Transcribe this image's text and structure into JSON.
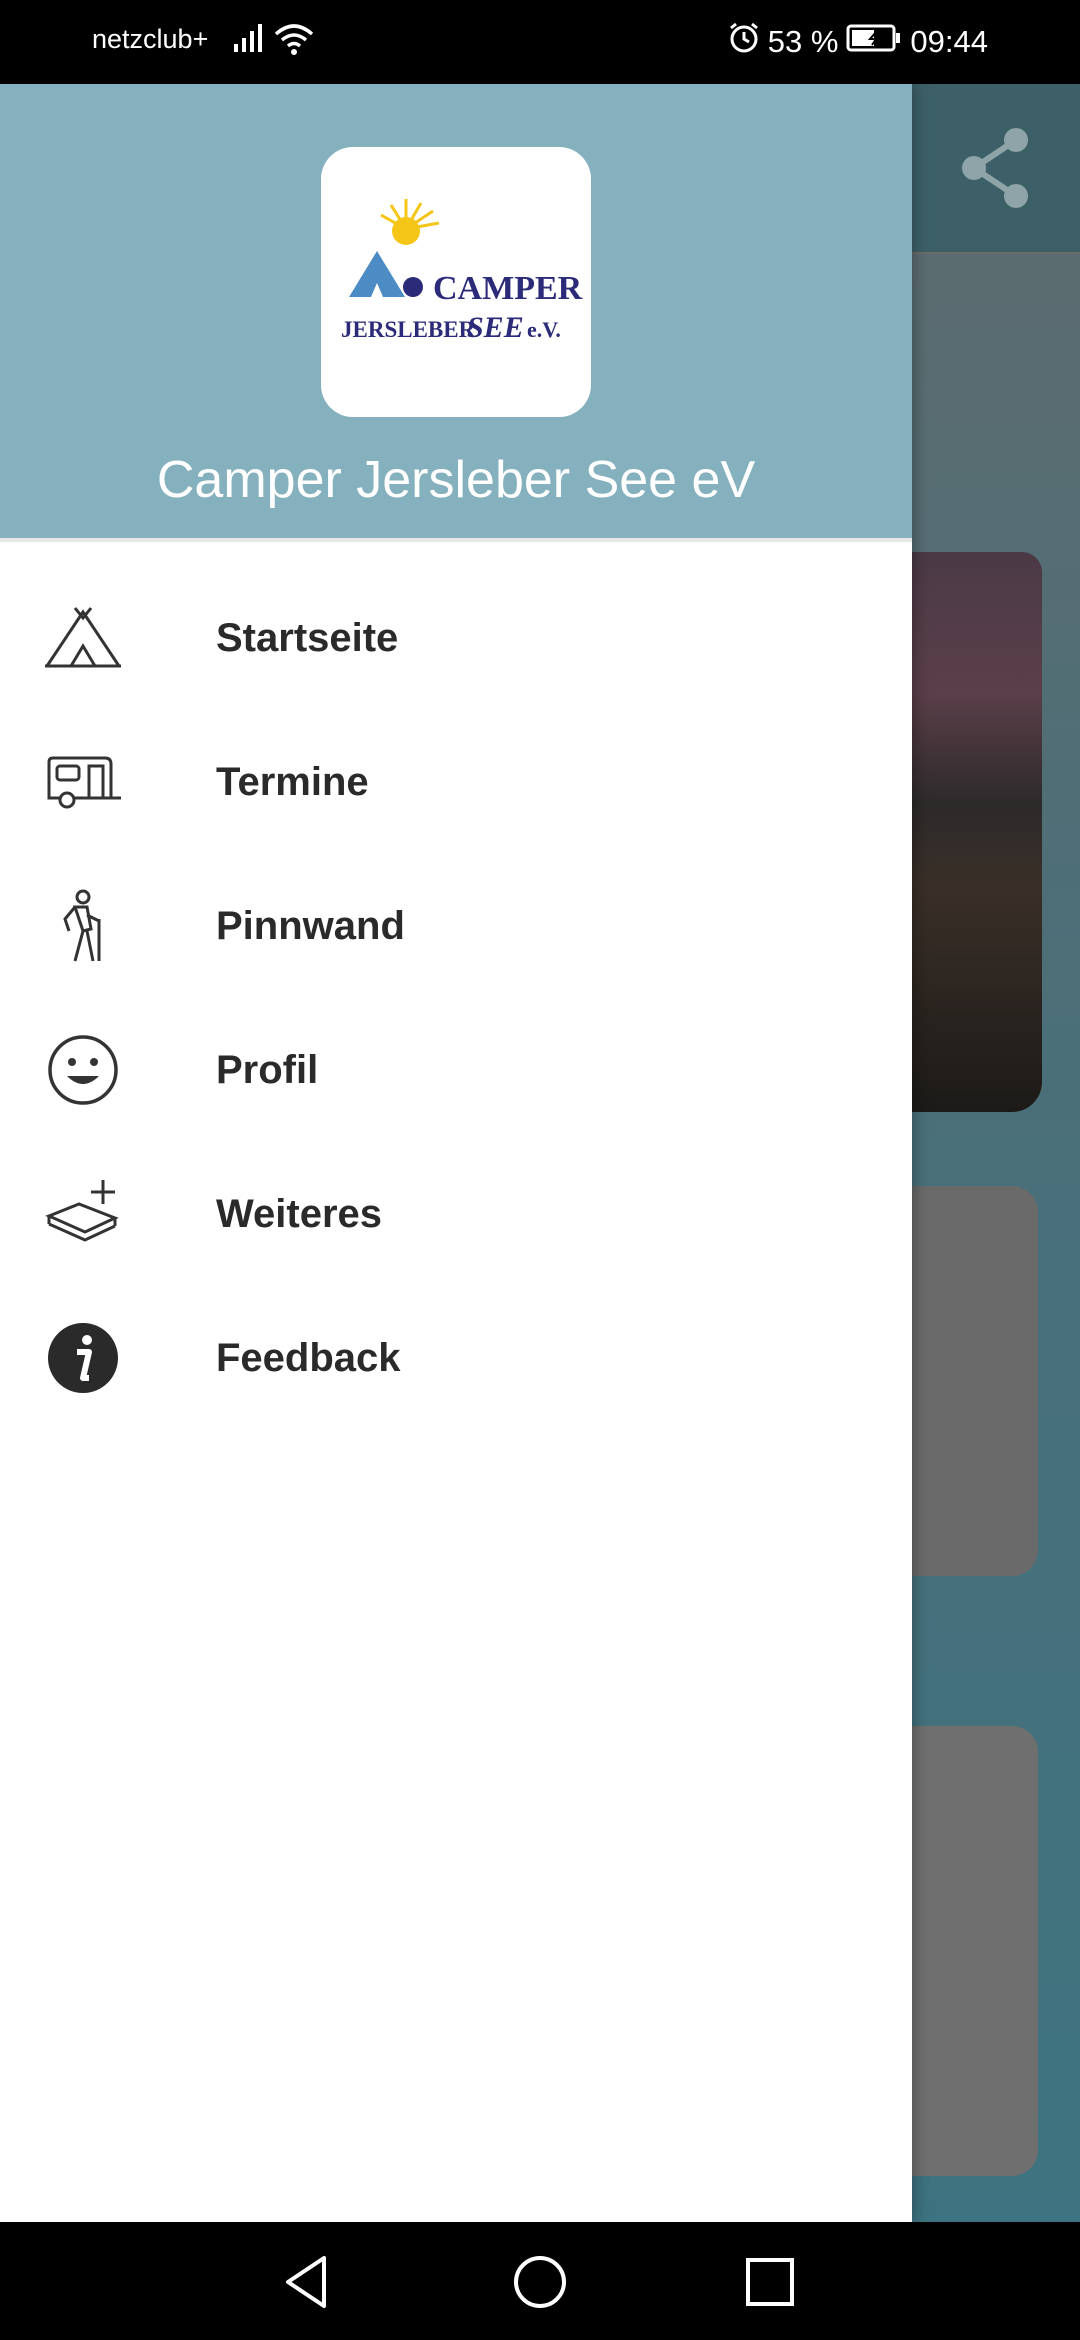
{
  "status_bar": {
    "carrier": "netzclub+",
    "battery_percent": "53 %",
    "time": "09:44"
  },
  "drawer": {
    "title": "Camper Jersleber See eV",
    "logo": {
      "line1": "CAMPER",
      "line2_left": "JERSLEBER",
      "line2_mid": "SEE",
      "line2_right": "e.V."
    },
    "items": [
      {
        "label": "Startseite",
        "icon": "tent-icon"
      },
      {
        "label": "Termine",
        "icon": "caravan-icon"
      },
      {
        "label": "Pinnwand",
        "icon": "hiker-icon"
      },
      {
        "label": "Profil",
        "icon": "smiley-icon"
      },
      {
        "label": "Weiteres",
        "icon": "layers-plus-icon"
      },
      {
        "label": "Feedback",
        "icon": "info-icon"
      }
    ]
  },
  "colors": {
    "drawer_header": "#84b1bd",
    "status_bar": "#000000",
    "logo_blue": "#2b2b7a",
    "logo_sun": "#f5c518"
  }
}
